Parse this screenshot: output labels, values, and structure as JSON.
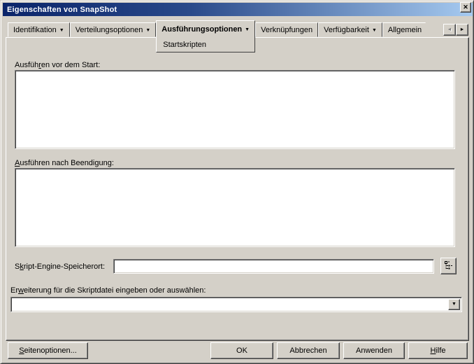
{
  "window": {
    "title": "Eigenschaften von SnapShot",
    "close_glyph": "✕"
  },
  "icons": {
    "tab_dropdown": "▼",
    "combo_dropdown": "▼",
    "scroll_left": "◄",
    "scroll_right": "►",
    "browse": "tree-browse-icon"
  },
  "tabs": {
    "identifikation": "Identifikation",
    "verteilungsoptionen": "Verteilungsoptionen",
    "ausfuehrungsoptionen": "Ausführungsoptionen",
    "ausfuehrungsoptionen_sub": "Startskripten",
    "verknuepfungen": "Verknüpfungen",
    "verfuegbarkeit": "Verfügbarkeit",
    "allgemein": "Allgemein"
  },
  "fields": {
    "run_before": {
      "pre": "Ausfüh",
      "mn": "r",
      "post": "en vor dem Start:",
      "value": ""
    },
    "run_after": {
      "pre": "",
      "mn": "A",
      "post": "usführen nach Beendigung:",
      "value": ""
    },
    "engine": {
      "pre": "S",
      "mn": "k",
      "post": "ript-Engine-Speicherort:",
      "value": ""
    },
    "extension": {
      "pre": "Er",
      "mn": "w",
      "post": "eiterung für die Skriptdatei eingeben oder auswählen:",
      "value": ""
    }
  },
  "buttons": {
    "page_options": {
      "pre": "",
      "mn": "S",
      "post": "eitenoptionen..."
    },
    "ok": {
      "pre": "",
      "mn": "",
      "post": "OK"
    },
    "cancel": {
      "pre": "",
      "mn": "",
      "post": "Abbrechen"
    },
    "apply": {
      "pre": "",
      "mn": "",
      "post": "Anwenden"
    },
    "help": {
      "pre": "",
      "mn": "H",
      "post": "ilfe"
    }
  },
  "colors": {
    "titlebar_gradient_start": "#0A246A",
    "titlebar_gradient_end": "#A6CAF0",
    "dialog_background": "#D4D0C8",
    "field_background": "#FFFFFF"
  }
}
